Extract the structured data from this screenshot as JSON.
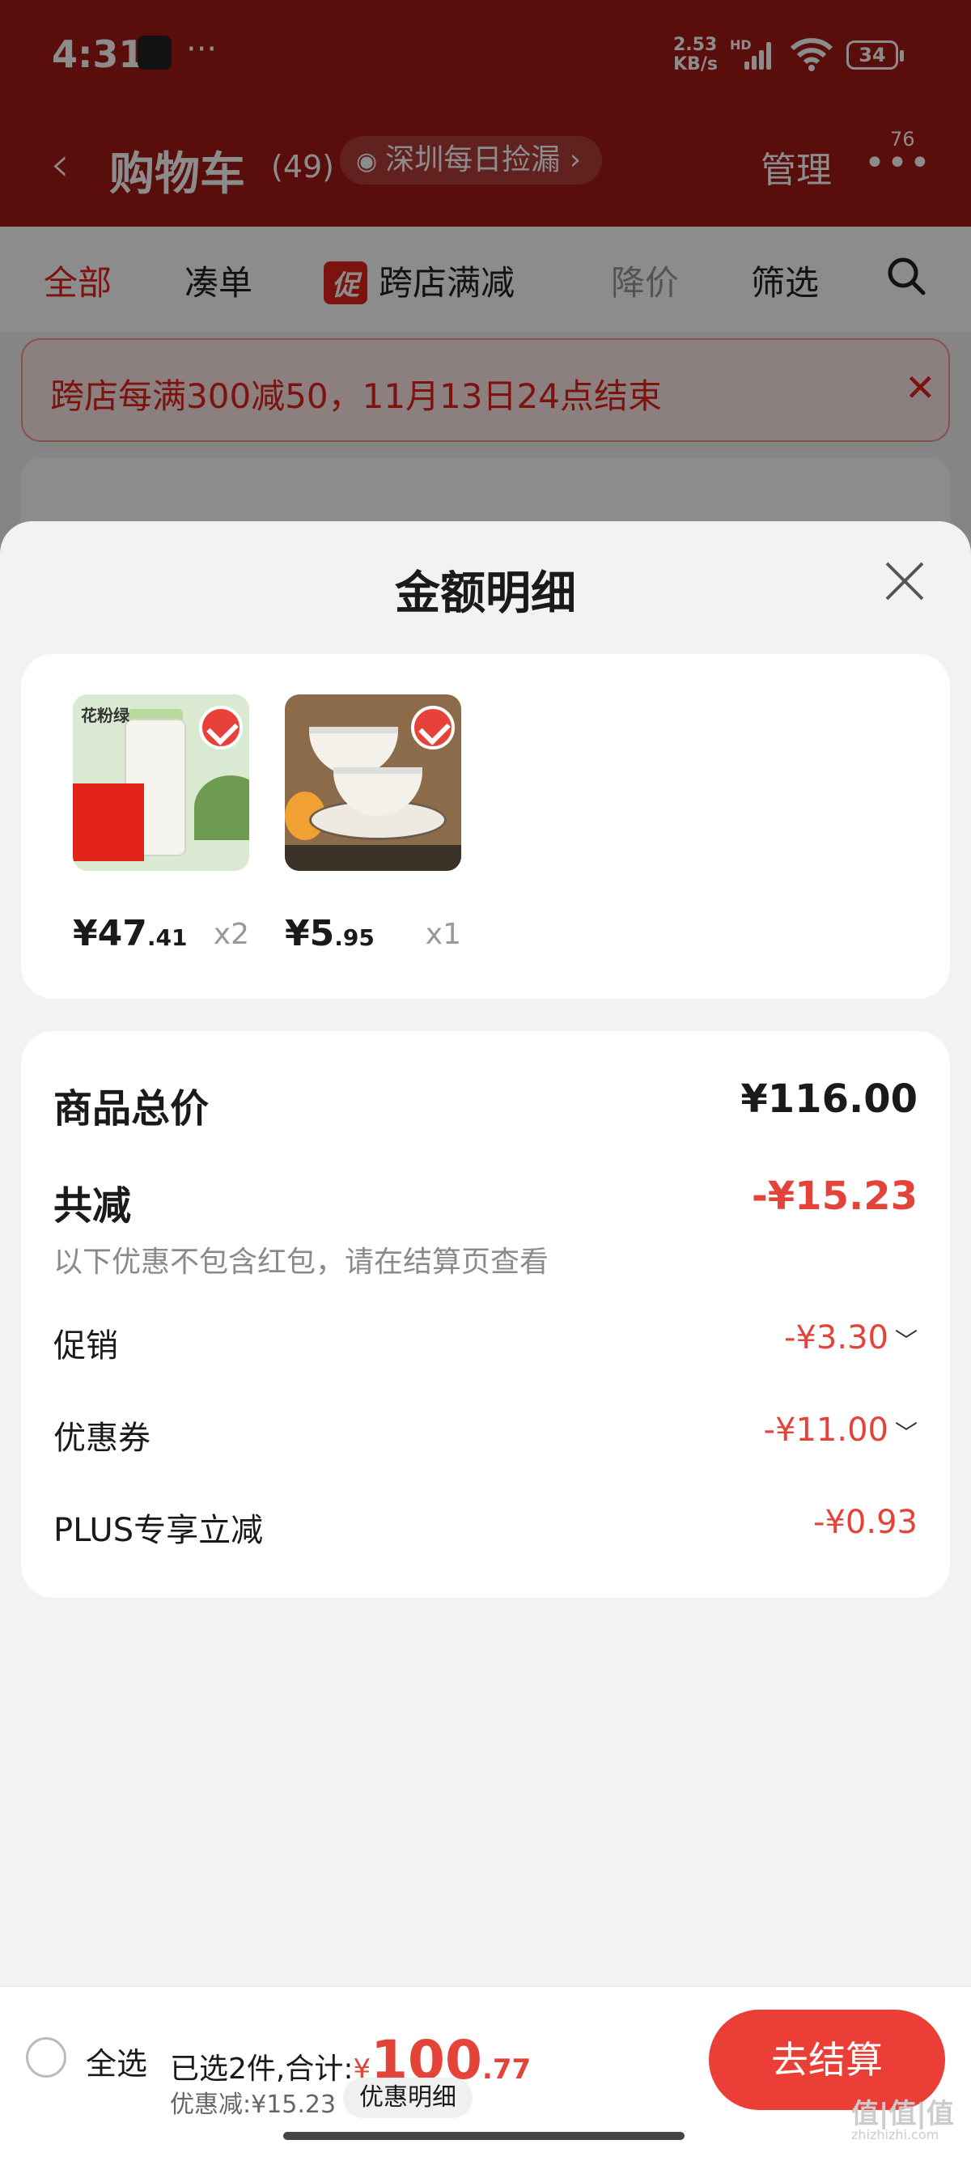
{
  "status_bar": {
    "time": "4:31",
    "dots": "···",
    "net_speed": "2.53\nKB/s",
    "net_top": "2.53",
    "net_bottom": "KB/s",
    "hd": "HD",
    "battery": "34"
  },
  "header": {
    "back": "‹",
    "title": "购物车",
    "count": "(49)",
    "location": "深圳每日捡漏 ›",
    "manage": "管理",
    "more": "•••",
    "badge": "76"
  },
  "tabs": {
    "all": "全部",
    "bundle": "凑单",
    "promo_tag": "促",
    "cross_store": "跨店满减",
    "price_drop": "降价",
    "filter": "筛选"
  },
  "banner": {
    "text": "跨店每满300减50，11月13日24点结束",
    "close": "✕"
  },
  "sheet": {
    "title": "金额明细",
    "products": [
      {
        "label": "花粉绿",
        "price_int": "¥47",
        "price_dec": ".41",
        "qty": "x2"
      },
      {
        "label": "",
        "price_int": "¥5",
        "price_dec": ".95",
        "qty": "x1"
      }
    ],
    "summary": {
      "total_label": "商品总价",
      "total_value": "¥116.00",
      "reduce_label": "共减",
      "reduce_value": "-¥15.23",
      "note": "以下优惠不包含红包，请在结算页查看",
      "promo_label": "促销",
      "promo_value": "-¥3.30",
      "coupon_label": "优惠券",
      "coupon_value": "-¥11.00",
      "plus_label": "PLUS专享立减",
      "plus_value": "-¥0.93"
    }
  },
  "bottom_bar": {
    "select_all": "全选",
    "selected_text": "已选2件,合计:",
    "yen": "¥",
    "amount_int": "100",
    "amount_dec": ".77",
    "discount": "优惠减:¥15.23",
    "detail": "优惠明细",
    "checkout": "去结算"
  },
  "watermark": {
    "main": "值|值|值",
    "sub": "zhizhizhi.com"
  },
  "colors": {
    "header_red": "#a31a14",
    "accent_red": "#e4433a",
    "checkout_red": "#ea3e36"
  }
}
